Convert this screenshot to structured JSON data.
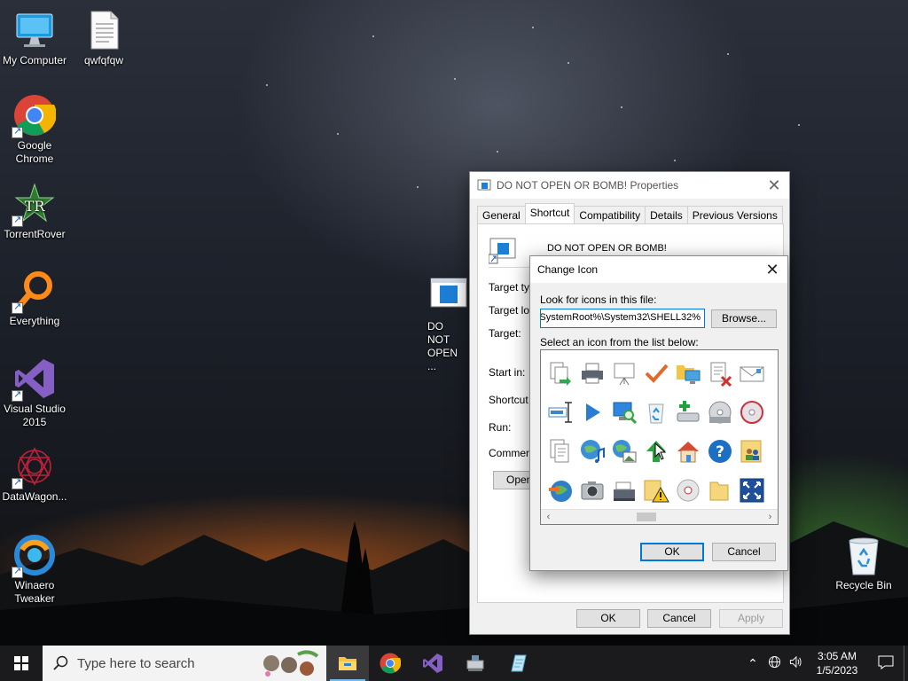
{
  "desktop": {
    "icons": [
      {
        "label": "My Computer",
        "icon": "computer-icon"
      },
      {
        "label": "qwfqfqw",
        "icon": "text-file-icon"
      },
      {
        "label": "Google Chrome",
        "icon": "chrome-icon"
      },
      {
        "label": "TorrentRover",
        "icon": "torrentrover-icon"
      },
      {
        "label": "Everything",
        "icon": "everything-search-icon"
      },
      {
        "label": "Visual Studio 2015",
        "icon": "visual-studio-icon"
      },
      {
        "label": "DataWagon...",
        "icon": "datawagon-icon"
      },
      {
        "label": "Winaero Tweaker",
        "icon": "winaero-tweaker-icon"
      },
      {
        "label": "DO NOT OPEN ...",
        "icon": "shortcut-window-icon"
      },
      {
        "label": "Recycle Bin",
        "icon": "recycle-bin-icon"
      }
    ]
  },
  "properties": {
    "title": "DO NOT OPEN OR BOMB! Properties",
    "tabs": [
      "General",
      "Shortcut",
      "Compatibility",
      "Details",
      "Previous Versions"
    ],
    "active_tab": "Shortcut",
    "shortcut_name": "DO NOT OPEN OR BOMB!",
    "labels": {
      "target_type": "Target typ",
      "target_location": "Target loc",
      "target": "Target:",
      "start_in": "Start in:",
      "shortcut_key": "Shortcut k",
      "run": "Run:",
      "comment": "Comment:",
      "open": "Open"
    },
    "buttons": {
      "ok": "OK",
      "cancel": "Cancel",
      "apply": "Apply"
    }
  },
  "change_icon": {
    "title": "Change Icon",
    "look_label": "Look for icons in this file:",
    "file_path": "%SystemRoot%\\System32\\SHELL32",
    "browse": "Browse...",
    "list_label": "Select an icon from the list below:",
    "icons": [
      "copy-to-icon",
      "printer-icon",
      "presentation-board-icon",
      "checkmark-icon",
      "network-folder-icon",
      "delete-document-icon",
      "envelope-icon",
      "user-partial-icon",
      "text-cursor-icon",
      "play-icon",
      "computer-search-icon",
      "recycle-bin-icon",
      "add-drive-icon",
      "cd-drive-icon",
      "dvd-disc-icon",
      "device-partial-icon",
      "document-icon",
      "globe-music-icon",
      "globe-picture-icon",
      "green-up-arrow-icon",
      "home-icon",
      "help-icon",
      "users-folder-icon",
      "partial-icon",
      "globe-arrow-icon",
      "camera-icon",
      "scanner-icon",
      "warning-folder-icon",
      "disc-icon",
      "folder-icon",
      "fullscreen-icon",
      "partial-icon-2"
    ],
    "buttons": {
      "ok": "OK",
      "cancel": "Cancel"
    }
  },
  "taskbar": {
    "search_placeholder": "Type here to search",
    "apps": [
      "file-explorer-icon",
      "chrome-icon",
      "visual-studio-icon",
      "network-app-icon",
      "notepad-app-icon"
    ],
    "time": "3:05 AM",
    "date": "1/5/2023"
  }
}
